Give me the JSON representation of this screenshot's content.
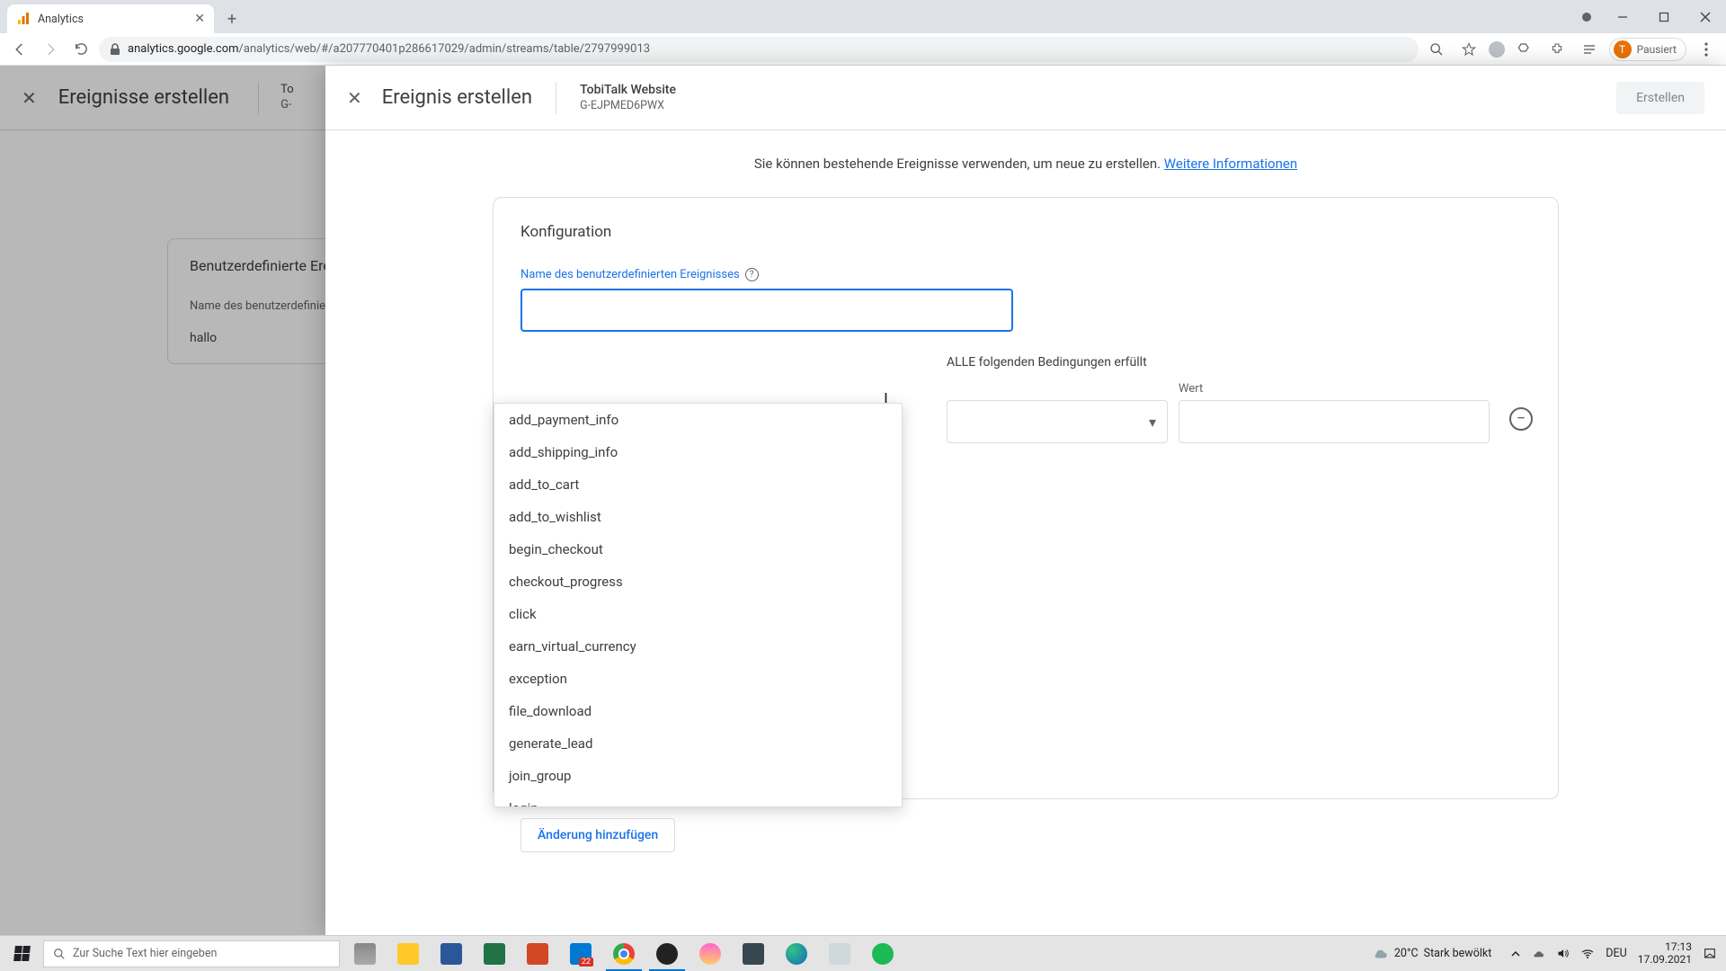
{
  "browser": {
    "tab_title": "Analytics",
    "profile_status": "Pausiert",
    "profile_initial": "T",
    "url_host": "analytics.google.com",
    "url_path": "/analytics/web/#/a207770401p286617029/admin/streams/table/2797999013"
  },
  "background": {
    "title": "Ereignisse erstellen",
    "card_heading": "Benutzerdefinierte Ereignisse",
    "col_label": "Name des benutzerdefinierten Ereignisses",
    "row_value": "hallo",
    "meta_name_partial": "To",
    "meta_id_partial": "G-"
  },
  "panel": {
    "title": "Ereignis erstellen",
    "property_name": "TobiTalk Website",
    "property_id": "G-EJPMED6PWX",
    "create_button": "Erstellen",
    "info_text": "Sie können bestehende Ereignisse verwenden, um neue zu erstellen. ",
    "info_link": "Weitere Informationen",
    "card_title": "Konfiguration",
    "name_label": "Name des benutzerdefinierten Ereignisses",
    "name_value": "",
    "conditions_suffix": "ALLE folgenden Bedingungen erfüllt",
    "value_label": "Wert",
    "add_change": "Änderung hinzufügen",
    "dropdown_options": [
      "add_payment_info",
      "add_shipping_info",
      "add_to_cart",
      "add_to_wishlist",
      "begin_checkout",
      "checkout_progress",
      "click",
      "earn_virtual_currency",
      "exception",
      "file_download",
      "generate_lead",
      "join_group",
      "login"
    ]
  },
  "taskbar": {
    "search_placeholder": "Zur Suche Text hier eingeben",
    "weather_temp": "20°C",
    "weather_text": "Stark bewölkt",
    "mail_badge": "22",
    "lang": "DEU",
    "time": "17:13",
    "date": "17.09.2021"
  }
}
